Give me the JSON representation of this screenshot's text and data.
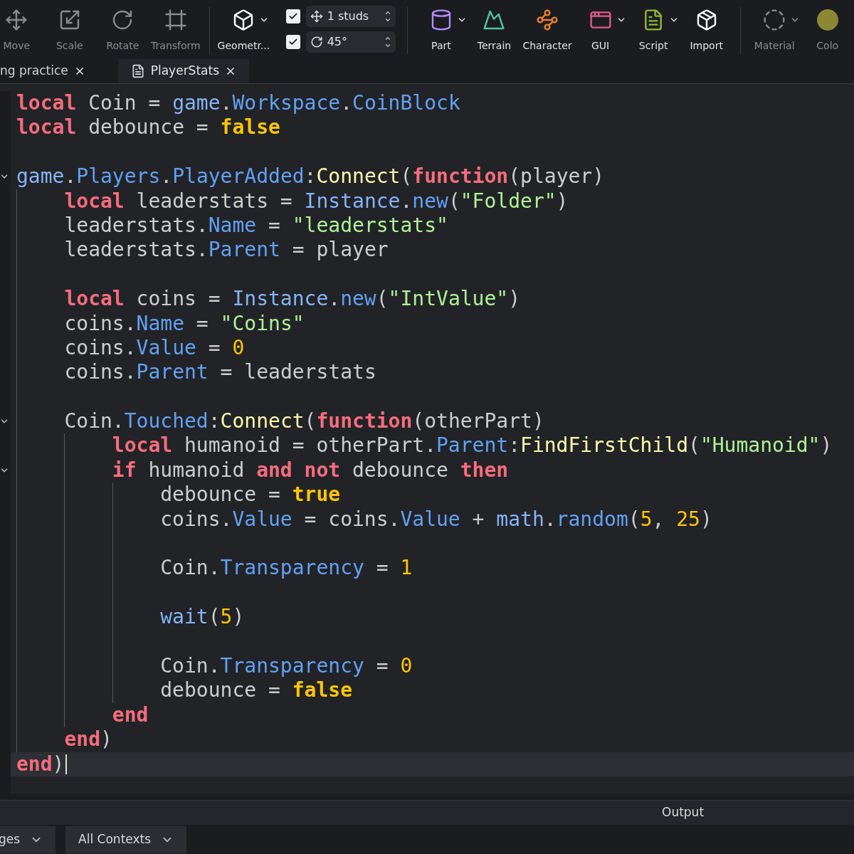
{
  "toolbar": {
    "items": [
      {
        "label": "Move",
        "disabled": true,
        "dropdown": false
      },
      {
        "label": "Scale",
        "disabled": true,
        "dropdown": false
      },
      {
        "label": "Rotate",
        "disabled": true,
        "dropdown": false
      },
      {
        "label": "Transform",
        "disabled": true,
        "dropdown": false
      },
      {
        "label": "Geometr...",
        "disabled": false,
        "dropdown": true,
        "snap": [
          {
            "checked": true,
            "value": "1 studs"
          },
          {
            "checked": true,
            "value": "45°"
          }
        ]
      },
      {
        "label": "Part",
        "disabled": false,
        "dropdown": true
      },
      {
        "label": "Terrain",
        "disabled": false,
        "dropdown": false
      },
      {
        "label": "Character",
        "disabled": false,
        "dropdown": false
      },
      {
        "label": "GUI",
        "disabled": false,
        "dropdown": true
      },
      {
        "label": "Script",
        "disabled": false,
        "dropdown": true
      },
      {
        "label": "Import",
        "disabled": false,
        "dropdown": false
      },
      {
        "label": "Material",
        "disabled": true,
        "dropdown": true
      },
      {
        "label": "Colo",
        "disabled": true,
        "dropdown": false
      }
    ]
  },
  "tabs": [
    {
      "label": "ng practice",
      "selected": false
    },
    {
      "label": "PlayerStats",
      "selected": true
    }
  ],
  "editor": {
    "lines": [
      {
        "fold": false,
        "current": false,
        "tokens": [
          {
            "kind": "kw",
            "text": "local"
          },
          {
            "kind": "id",
            "text": " Coin = "
          },
          {
            "kind": "bi",
            "text": "game"
          },
          {
            "kind": "id",
            "text": "."
          },
          {
            "kind": "mem",
            "text": "Workspace"
          },
          {
            "kind": "id",
            "text": "."
          },
          {
            "kind": "mem",
            "text": "CoinBlock"
          }
        ]
      },
      {
        "fold": false,
        "current": false,
        "tokens": [
          {
            "kind": "kw",
            "text": "local"
          },
          {
            "kind": "id",
            "text": " debounce = "
          },
          {
            "kind": "bool",
            "text": "false"
          }
        ]
      },
      {
        "fold": false,
        "current": false
      },
      {
        "fold": true,
        "current": false,
        "tokens": [
          {
            "kind": "bi",
            "text": "game"
          },
          {
            "kind": "id",
            "text": "."
          },
          {
            "kind": "mem",
            "text": "Players"
          },
          {
            "kind": "id",
            "text": "."
          },
          {
            "kind": "mem",
            "text": "PlayerAdded"
          },
          {
            "kind": "id",
            "text": ":"
          },
          {
            "kind": "fn",
            "text": "Connect"
          },
          {
            "kind": "id",
            "text": "("
          },
          {
            "kind": "kw",
            "text": "function"
          },
          {
            "kind": "id",
            "text": "(player)"
          }
        ],
        "children": [
          {
            "fold": false,
            "current": false,
            "tokens": [
              {
                "kind": "kw",
                "text": "local"
              },
              {
                "kind": "id",
                "text": " leaderstats = "
              },
              {
                "kind": "bi",
                "text": "Instance"
              },
              {
                "kind": "id",
                "text": "."
              },
              {
                "kind": "mem",
                "text": "new"
              },
              {
                "kind": "id",
                "text": "("
              },
              {
                "kind": "str",
                "text": "\"Folder\""
              },
              {
                "kind": "id",
                "text": ")"
              }
            ]
          },
          {
            "fold": false,
            "current": false,
            "tokens": [
              {
                "kind": "id",
                "text": "leaderstats."
              },
              {
                "kind": "mem",
                "text": "Name"
              },
              {
                "kind": "id",
                "text": " = "
              },
              {
                "kind": "str",
                "text": "\"leaderstats\""
              }
            ]
          },
          {
            "fold": false,
            "current": false,
            "tokens": [
              {
                "kind": "id",
                "text": "leaderstats."
              },
              {
                "kind": "mem",
                "text": "Parent"
              },
              {
                "kind": "id",
                "text": " = player"
              }
            ]
          },
          {
            "fold": false,
            "current": false
          },
          {
            "fold": false,
            "current": false,
            "tokens": [
              {
                "kind": "kw",
                "text": "local"
              },
              {
                "kind": "id",
                "text": " coins = "
              },
              {
                "kind": "bi",
                "text": "Instance"
              },
              {
                "kind": "id",
                "text": "."
              },
              {
                "kind": "mem",
                "text": "new"
              },
              {
                "kind": "id",
                "text": "("
              },
              {
                "kind": "str",
                "text": "\"IntValue\""
              },
              {
                "kind": "id",
                "text": ")"
              }
            ]
          },
          {
            "fold": false,
            "current": false,
            "tokens": [
              {
                "kind": "id",
                "text": "coins."
              },
              {
                "kind": "mem",
                "text": "Name"
              },
              {
                "kind": "id",
                "text": " = "
              },
              {
                "kind": "str",
                "text": "\"Coins\""
              }
            ]
          },
          {
            "fold": false,
            "current": false,
            "tokens": [
              {
                "kind": "id",
                "text": "coins."
              },
              {
                "kind": "mem",
                "text": "Value"
              },
              {
                "kind": "id",
                "text": " = "
              },
              {
                "kind": "num",
                "text": "0"
              }
            ]
          },
          {
            "fold": false,
            "current": false,
            "tokens": [
              {
                "kind": "id",
                "text": "coins."
              },
              {
                "kind": "mem",
                "text": "Parent"
              },
              {
                "kind": "id",
                "text": " = leaderstats"
              }
            ]
          },
          {
            "fold": false,
            "current": false
          },
          {
            "fold": true,
            "current": false,
            "tokens": [
              {
                "kind": "id",
                "text": "Coin."
              },
              {
                "kind": "mem",
                "text": "Touched"
              },
              {
                "kind": "id",
                "text": ":"
              },
              {
                "kind": "fn",
                "text": "Connect"
              },
              {
                "kind": "id",
                "text": "("
              },
              {
                "kind": "kw",
                "text": "function"
              },
              {
                "kind": "id",
                "text": "(otherPart)"
              }
            ],
            "children": [
              {
                "fold": false,
                "current": false,
                "tokens": [
                  {
                    "kind": "kw",
                    "text": "local"
                  },
                  {
                    "kind": "id",
                    "text": " humanoid = otherPart."
                  },
                  {
                    "kind": "mem",
                    "text": "Parent"
                  },
                  {
                    "kind": "id",
                    "text": ":"
                  },
                  {
                    "kind": "fn",
                    "text": "FindFirstChild"
                  },
                  {
                    "kind": "id",
                    "text": "("
                  },
                  {
                    "kind": "str",
                    "text": "\"Humanoid\""
                  },
                  {
                    "kind": "id",
                    "text": ")"
                  }
                ]
              },
              {
                "fold": true,
                "current": false,
                "tokens": [
                  {
                    "kind": "kw",
                    "text": "if"
                  },
                  {
                    "kind": "id",
                    "text": " humanoid "
                  },
                  {
                    "kind": "kw",
                    "text": "and not"
                  },
                  {
                    "kind": "id",
                    "text": " debounce "
                  },
                  {
                    "kind": "kw",
                    "text": "then"
                  }
                ],
                "children": [
                  {
                    "fold": false,
                    "current": false,
                    "tokens": [
                      {
                        "kind": "id",
                        "text": "debounce = "
                      },
                      {
                        "kind": "bool",
                        "text": "true"
                      }
                    ]
                  },
                  {
                    "fold": false,
                    "current": false,
                    "tokens": [
                      {
                        "kind": "id",
                        "text": "coins."
                      },
                      {
                        "kind": "mem",
                        "text": "Value"
                      },
                      {
                        "kind": "id",
                        "text": " = coins."
                      },
                      {
                        "kind": "mem",
                        "text": "Value"
                      },
                      {
                        "kind": "id",
                        "text": " + "
                      },
                      {
                        "kind": "bi",
                        "text": "math"
                      },
                      {
                        "kind": "id",
                        "text": "."
                      },
                      {
                        "kind": "mem",
                        "text": "random"
                      },
                      {
                        "kind": "id",
                        "text": "("
                      },
                      {
                        "kind": "num",
                        "text": "5"
                      },
                      {
                        "kind": "id",
                        "text": ", "
                      },
                      {
                        "kind": "num",
                        "text": "25"
                      },
                      {
                        "kind": "id",
                        "text": ")"
                      }
                    ]
                  },
                  {
                    "fold": false,
                    "current": false
                  },
                  {
                    "fold": false,
                    "current": false,
                    "tokens": [
                      {
                        "kind": "id",
                        "text": "Coin."
                      },
                      {
                        "kind": "mem",
                        "text": "Transparency"
                      },
                      {
                        "kind": "id",
                        "text": " = "
                      },
                      {
                        "kind": "num",
                        "text": "1"
                      }
                    ]
                  },
                  {
                    "fold": false,
                    "current": false
                  },
                  {
                    "fold": false,
                    "current": false,
                    "tokens": [
                      {
                        "kind": "bi",
                        "text": "wait"
                      },
                      {
                        "kind": "id",
                        "text": "("
                      },
                      {
                        "kind": "num",
                        "text": "5"
                      },
                      {
                        "kind": "id",
                        "text": ")"
                      }
                    ]
                  },
                  {
                    "fold": false,
                    "current": false
                  },
                  {
                    "fold": false,
                    "current": false,
                    "tokens": [
                      {
                        "kind": "id",
                        "text": "Coin."
                      },
                      {
                        "kind": "mem",
                        "text": "Transparency"
                      },
                      {
                        "kind": "id",
                        "text": " = "
                      },
                      {
                        "kind": "num",
                        "text": "0"
                      }
                    ]
                  },
                  {
                    "fold": false,
                    "current": false,
                    "tokens": [
                      {
                        "kind": "id",
                        "text": "debounce = "
                      },
                      {
                        "kind": "bool",
                        "text": "false"
                      }
                    ]
                  }
                ]
              },
              {
                "fold": false,
                "current": false,
                "tokens": [
                  {
                    "kind": "kw",
                    "text": "end"
                  }
                ]
              }
            ]
          },
          {
            "fold": false,
            "current": false,
            "tokens": [
              {
                "kind": "kw",
                "text": "end"
              },
              {
                "kind": "id",
                "text": ")"
              }
            ]
          }
        ]
      },
      {
        "fold": false,
        "current": true,
        "tokens": [
          {
            "kind": "kw",
            "text": "end"
          },
          {
            "kind": "id",
            "text": ")"
          }
        ]
      }
    ]
  },
  "output_panel": {
    "title": "Output",
    "filters": [
      "ges",
      "All Contexts"
    ]
  }
}
